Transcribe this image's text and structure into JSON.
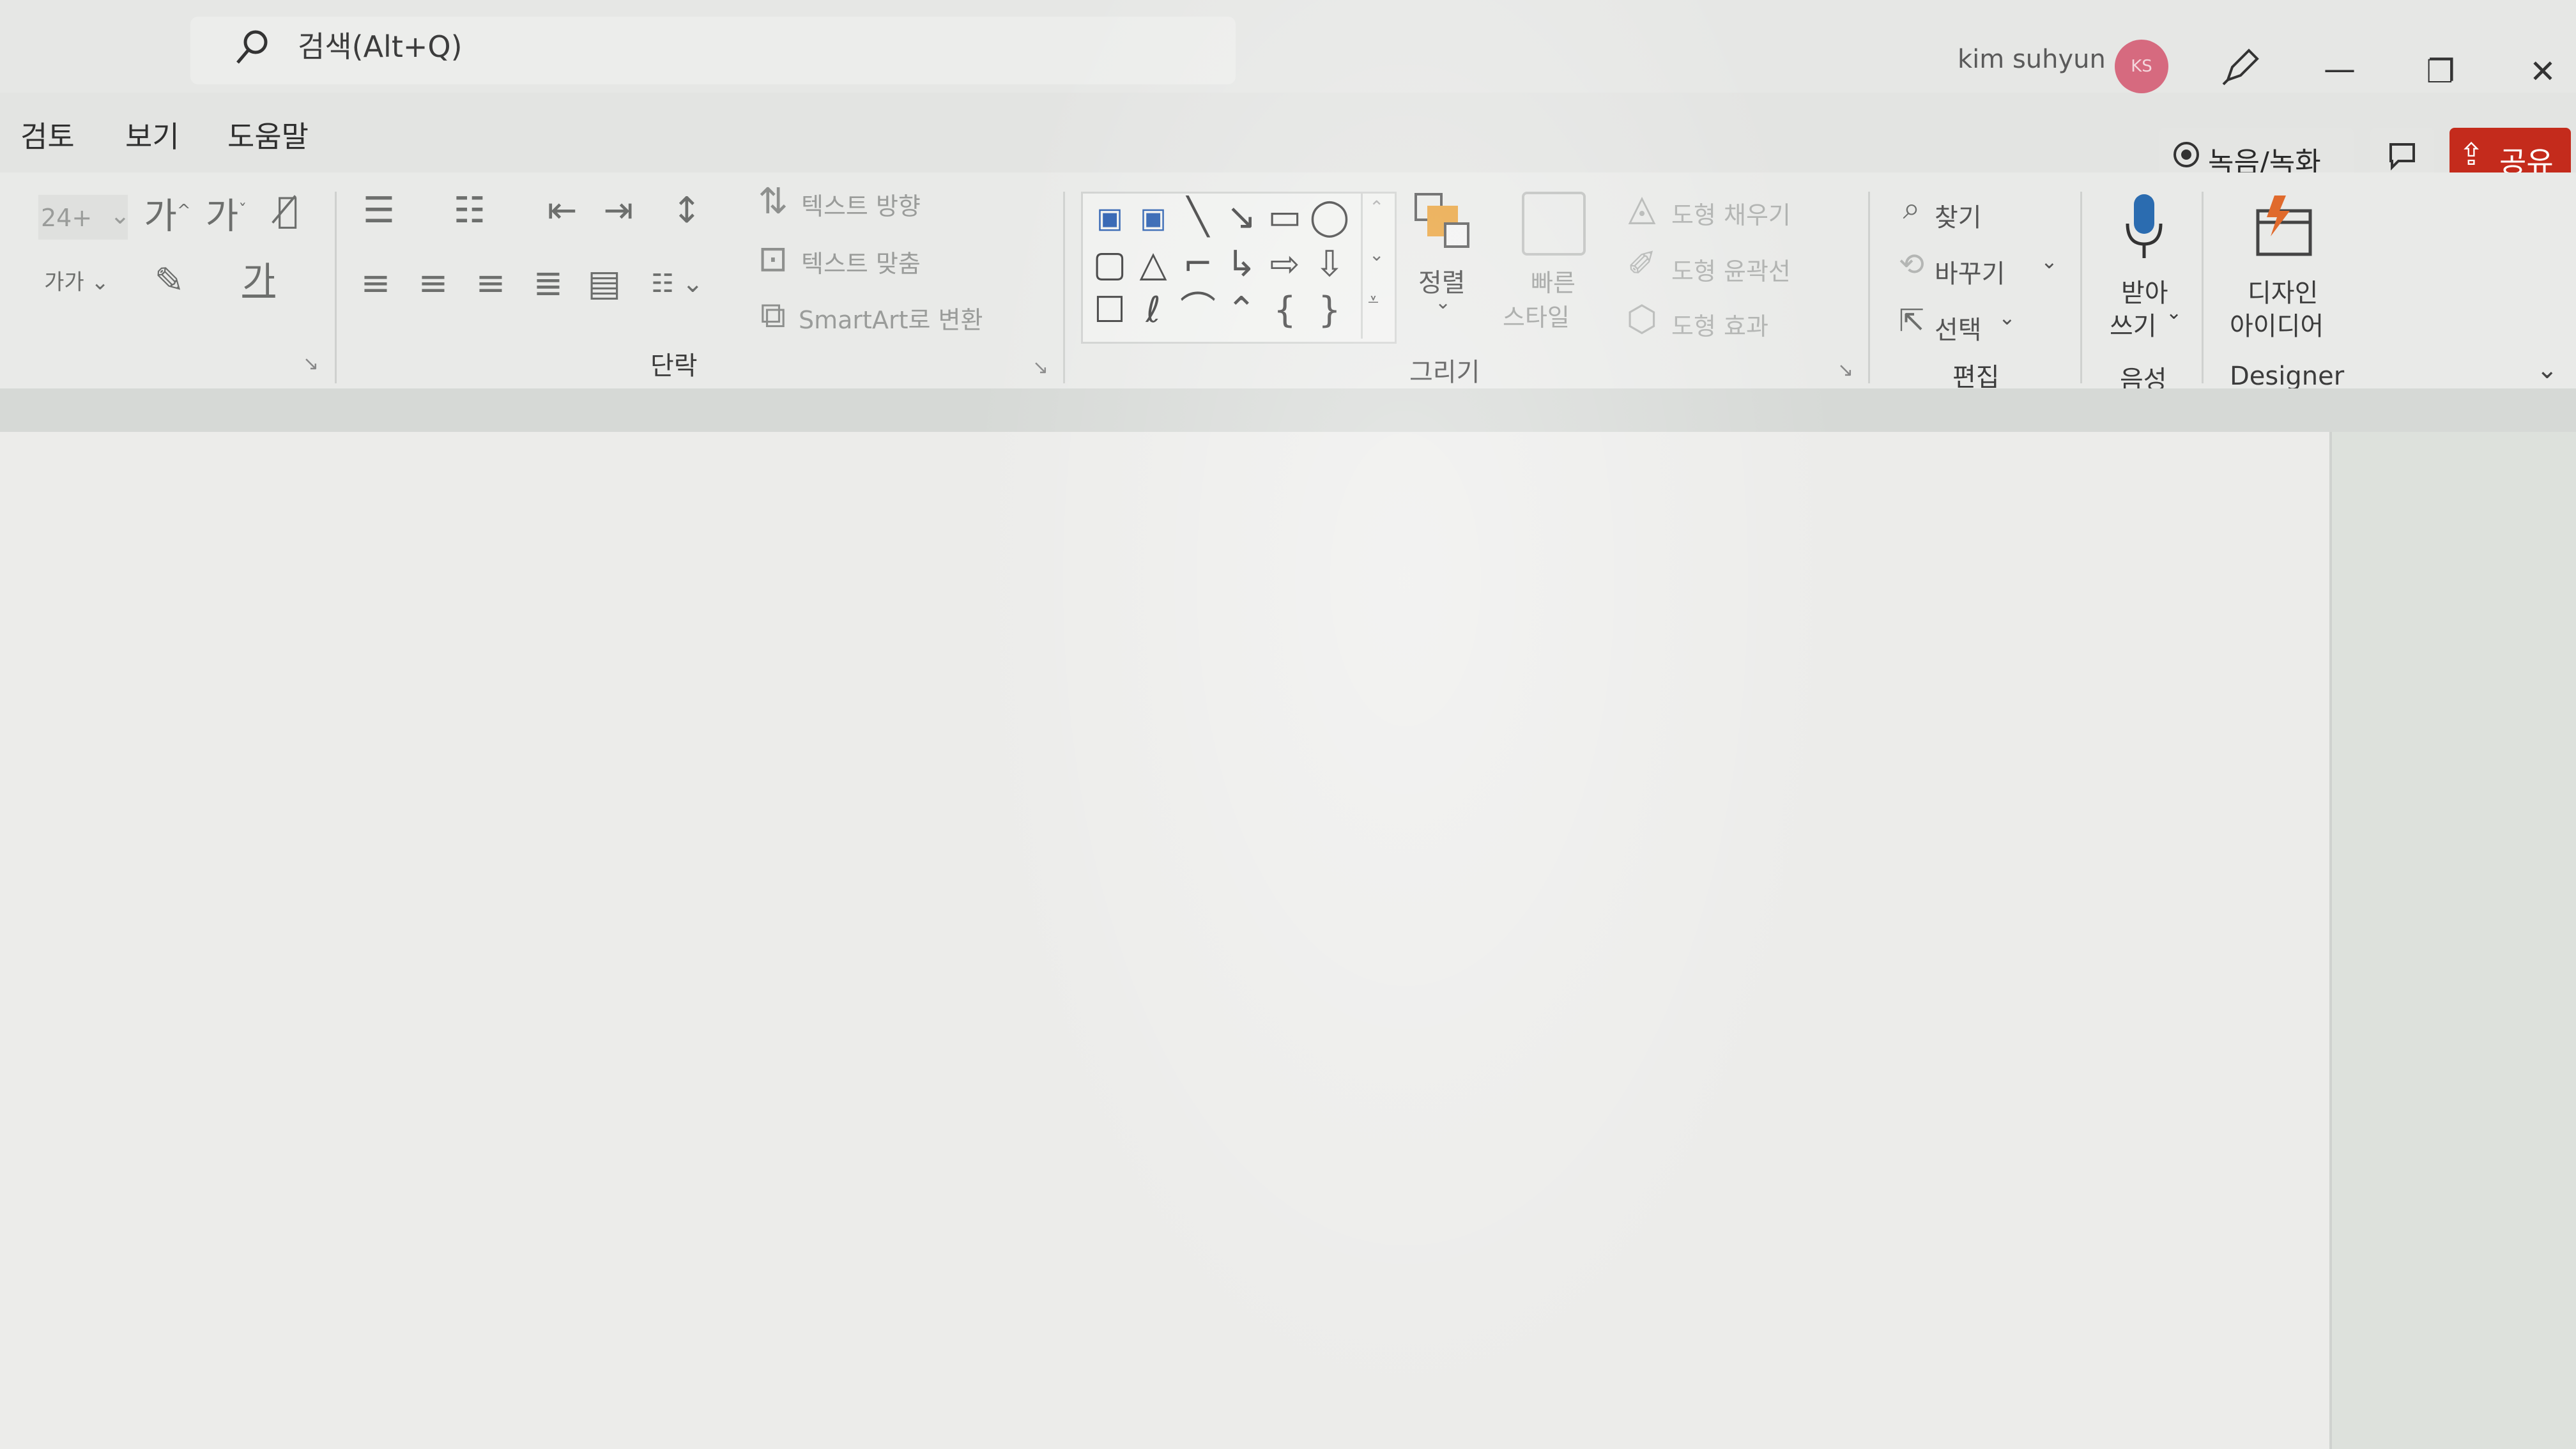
{
  "search": {
    "placeholder": "검색(Alt+Q)"
  },
  "user": {
    "name": "kim suhyun",
    "initials": "KS"
  },
  "menu": {
    "items": [
      "검토",
      "보기",
      "도움말"
    ]
  },
  "topActions": {
    "record": "녹음/녹화",
    "share": "공유"
  },
  "font": {
    "size": "24+"
  },
  "paragraph": {
    "text_direction": "텍스트 방향",
    "align_text": "텍스트 맞춤",
    "smartart": "SmartArt로 변환",
    "label": "단락"
  },
  "drawing": {
    "arrange": "정렬",
    "quick_styles": [
      "빠른",
      "스타일"
    ],
    "shape_fill": "도형 채우기",
    "shape_outline": "도형 윤곽선",
    "shape_effects": "도형 효과",
    "label": "그리기"
  },
  "editing": {
    "find": "찾기",
    "replace": "바꾸기",
    "select": "선택",
    "label": "편집"
  },
  "voice": {
    "dictate": [
      "받아",
      "쓰기"
    ],
    "label": "음성"
  },
  "designer": {
    "ideas": [
      "디자인",
      "아이디어"
    ],
    "label": "Designer"
  },
  "colors": {
    "accent": "#c42b1c",
    "avatar": "#d66a7f",
    "mic": "#2b6cb0"
  }
}
